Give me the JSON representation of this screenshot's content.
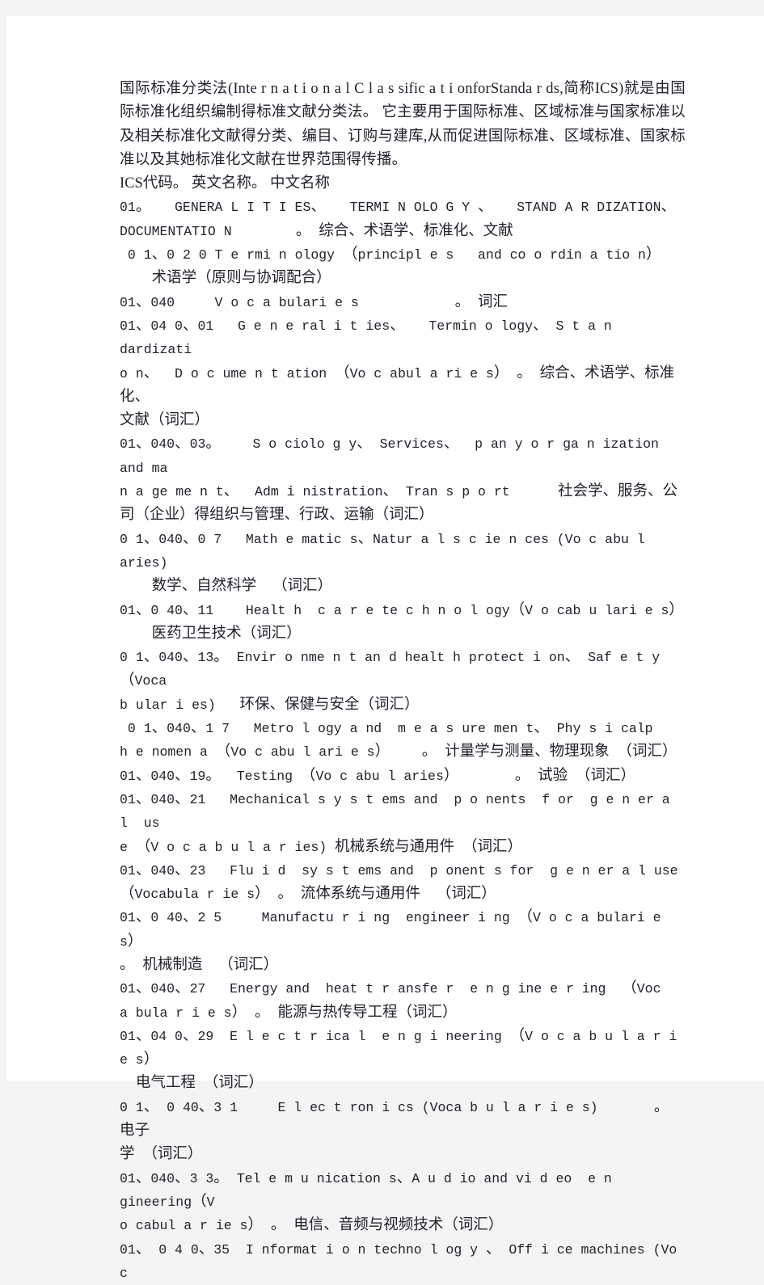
{
  "document": {
    "intro_paragraph": "国际标准分类法(Inte r n a t i o n a l C l a s sific a t i onforStanda r ds,简称ICS)就是由国际标准化组织编制得标准文献分类法。 它主要用于国际标准、区域标准与国家标准以及相关标准化文献得分类、编目、订购与建库,从而促进国际标准、区域标准、国家标准以及其她标准化文献在世界范围得传播。",
    "column_header": "ICS代码。 英文名称。 中文名称",
    "entries": [
      {
        "lines": [
          "01。   GENERA L I T I ES、   TERMI N OLO G Y 、   STAND A R DIZATION、",
          "DOCUMENTATIO N        。 综合、术语学、标准化、文献"
        ]
      },
      {
        "lines": [
          " 0 1、0 2 0 T e rmi n ology （principl e s   and co o rdin a tio n）",
          "    术语学（原则与协调配合）"
        ]
      },
      {
        "lines": [
          "01、040     V o c a bulari e s            。 词汇"
        ]
      },
      {
        "lines": [
          "01、04 0、01   G e n e ral i t ies、   Termin o logy、 S t a n dardizati",
          "o n、  D o c ume n t ation （Vo c abul a ri e s） 。 综合、术语学、标准化、",
          "文献（词汇）"
        ]
      },
      {
        "lines": [
          "01、040、03。    S o ciolo g y、 Services、  p an y o r ga n ization and ma",
          "n a ge me n t、  Adm i nistration、 Tran s p o rt      社会学、服务、公",
          "司（企业）得组织与管理、行政、运输（词汇）"
        ]
      },
      {
        "lines": [
          "0 1、040、0 7   Math e matic s、Natur a l s c ie n ces (Vo c abu l aries)",
          "    数学、自然科学  （词汇）"
        ]
      },
      {
        "lines": [
          "01、0 40、11    Healt h  c a r e te c h n o l ogy（V o cab u lari e s）",
          "    医药卫生技术（词汇）"
        ]
      },
      {
        "lines": [
          "0 1、040、13。 Envir o nme n t an d healt h protect i on、 Saf e t y（Voca",
          "b ular i es)   环保、保健与安全（词汇）"
        ]
      },
      {
        "lines": [
          " 0 1、040、1 7   Metro l ogy a nd  m e a s ure men t、 Phy s i calp",
          "h e nomen a （Vo c abu l ari e s）    。 计量学与测量、物理现象 （词汇）"
        ]
      },
      {
        "lines": [
          "01、040、19。  Testing （Vo c abu l aries）       。 试验 （词汇）"
        ]
      },
      {
        "lines": [
          "01、040、21   Mechanical s y s t ems and  p o nents  f or  g e n er a l  us",
          "e （V o c a b u l a r ies) 机械系统与通用件 （词汇）"
        ]
      },
      {
        "lines": [
          "01、040、23   Flu i d  sy s t ems and  p onent s for  g e n er a l use",
          "（Vocabula r ie s） 。 流体系统与通用件  （词汇）"
        ]
      },
      {
        "lines": [
          "01、0 40、2 5     Manufactu r i ng  engineer i ng （V o c a bulari e s）",
          "。 机械制造  （词汇）"
        ]
      },
      {
        "lines": [
          "01、040、27   Energy and  heat t r ansfe r  e n g ine e r ing  （Voc",
          "a bula r i e s） 。 能源与热传导工程（词汇）"
        ]
      },
      {
        "lines": [
          "01、04 0、29  E l e c t r ica l  e n g i neering （V o c a b u l a r i e s）",
          "  电气工程 （词汇）"
        ]
      },
      {
        "lines": [
          "0 1、 0 40、3 1     E l ec t ron i cs (Voca b u l a r i e s)       。 电子",
          "学 （词汇）"
        ]
      },
      {
        "lines": [
          "01、040、3 3。 Tel e m u nication s、A u d io and vi d eo  e n gineering（V",
          "o cabul a r ie s） 。 电信、音频与视频技术（词汇）"
        ]
      },
      {
        "lines": [
          "01、 0 4 0、35  I nformat i o n techno l og y 、 Off i ce machines (Vo c"
        ]
      }
    ]
  }
}
